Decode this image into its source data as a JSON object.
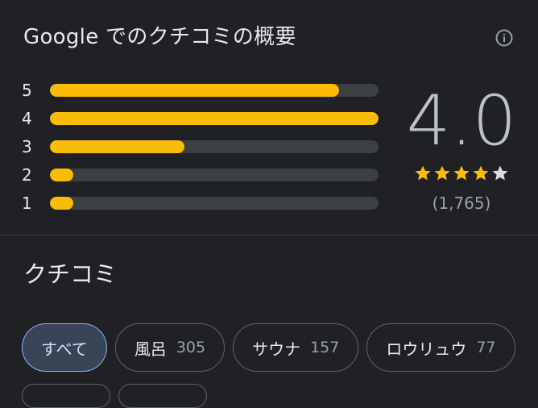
{
  "summary": {
    "title": "Google でのクチコミの概要",
    "info_icon": "info-icon"
  },
  "histogram": [
    {
      "label": "5",
      "fraction": 0.88
    },
    {
      "label": "4",
      "fraction": 1.0
    },
    {
      "label": "3",
      "fraction": 0.41
    },
    {
      "label": "2",
      "fraction": 0.07
    },
    {
      "label": "1",
      "fraction": 0.07
    }
  ],
  "rating": {
    "score": "4.0",
    "stars_filled": 4,
    "stars_total": 5,
    "count": "(1,765)"
  },
  "colors": {
    "bar_fill": "#fbbc04",
    "bar_track": "#3c4043",
    "star_filled": "#fbbc04",
    "star_empty": "#dadce0",
    "chip_selected_bg": "#394457",
    "chip_selected_border": "#8ab4f8"
  },
  "reviews": {
    "title": "クチコミ",
    "chips": [
      {
        "label": "すべて",
        "count": "",
        "selected": true
      },
      {
        "label": "風呂",
        "count": "305",
        "selected": false
      },
      {
        "label": "サウナ",
        "count": "157",
        "selected": false
      },
      {
        "label": "ロウリュウ",
        "count": "77",
        "selected": false
      }
    ]
  }
}
